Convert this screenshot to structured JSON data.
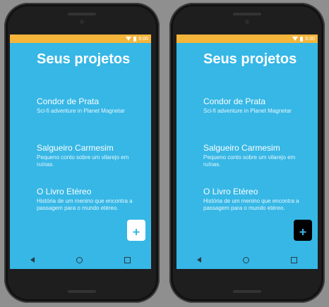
{
  "status": {
    "time": "6:00"
  },
  "title": "Seus projetos",
  "projects": [
    {
      "name": "Condor de Prata",
      "description": "Sci-fi adventure in Planet Magnetar"
    },
    {
      "name": "Salgueiro Carmesim",
      "description": "Pequeno conto sobre um vilarejo em ruínas."
    },
    {
      "name": "O Livro Etéreo",
      "description": "História de um menino que encontra a passagem para o mundo etéreo."
    }
  ],
  "fab": {
    "icon": "add-file-icon"
  },
  "colors": {
    "screen_bg": "#36b7e6",
    "status_bar": "#f5b53a",
    "fab_white": "#ffffff",
    "fab_black": "#000000",
    "fab_plus": "#36b7e6"
  }
}
